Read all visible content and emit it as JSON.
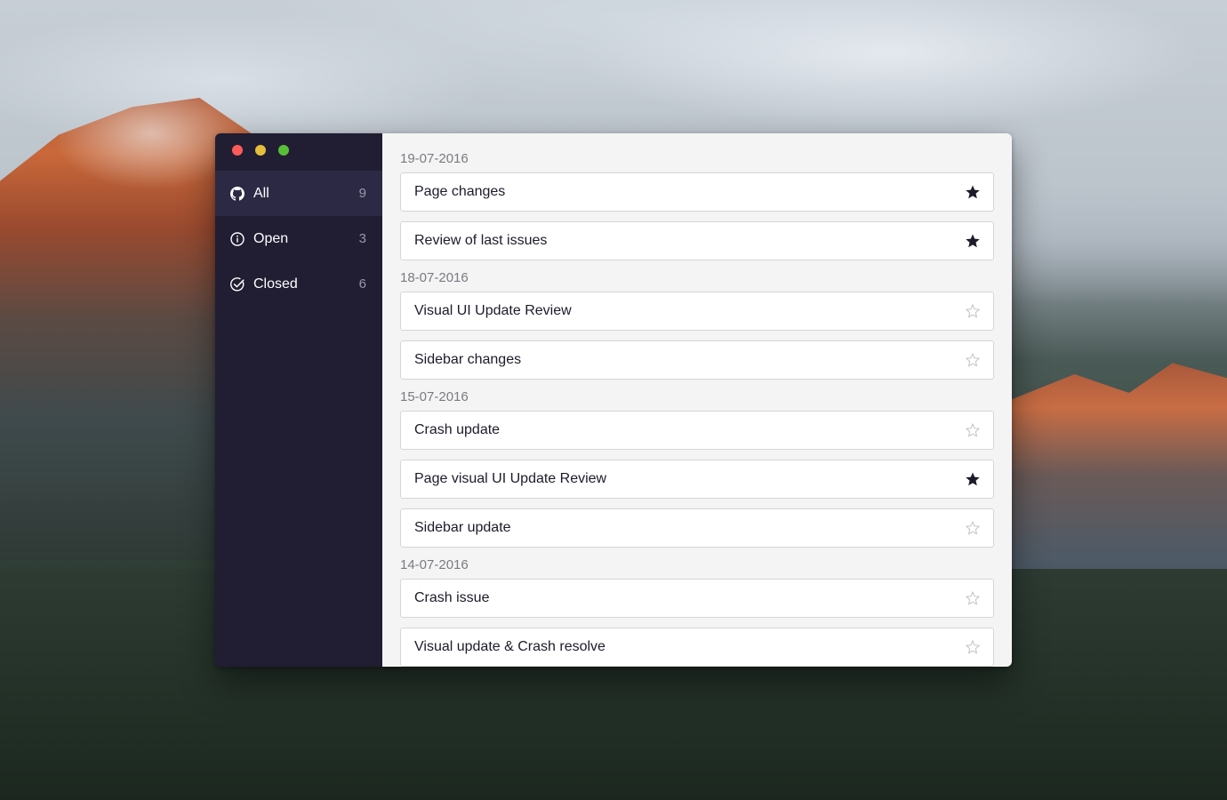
{
  "window": {
    "traffic_lights": {
      "close": "#fc5b57",
      "minimize": "#e5bf3c",
      "maximize": "#57c038"
    }
  },
  "sidebar": {
    "items": [
      {
        "label": "All",
        "count": "9",
        "icon": "github-icon",
        "active": true
      },
      {
        "label": "Open",
        "count": "3",
        "icon": "info-circle-icon",
        "active": false
      },
      {
        "label": "Closed",
        "count": "6",
        "icon": "check-circle-icon",
        "active": false
      }
    ]
  },
  "groups": [
    {
      "date": "19-07-2016",
      "issues": [
        {
          "title": "Page changes",
          "starred": true
        },
        {
          "title": "Review of last issues",
          "starred": true
        }
      ]
    },
    {
      "date": "18-07-2016",
      "issues": [
        {
          "title": "Visual UI Update Review",
          "starred": false
        },
        {
          "title": "Sidebar changes",
          "starred": false
        }
      ]
    },
    {
      "date": "15-07-2016",
      "issues": [
        {
          "title": "Crash update",
          "starred": false
        },
        {
          "title": "Page visual UI Update Review",
          "starred": true
        },
        {
          "title": "Sidebar update",
          "starred": false
        }
      ]
    },
    {
      "date": "14-07-2016",
      "issues": [
        {
          "title": "Crash issue",
          "starred": false
        },
        {
          "title": "Visual update & Crash resolve",
          "starred": false
        }
      ]
    }
  ],
  "colors": {
    "sidebar_bg": "#211d33",
    "sidebar_active": "#2c2944",
    "star_filled": "#1d1b2a",
    "star_empty": "#c8c8cc"
  }
}
